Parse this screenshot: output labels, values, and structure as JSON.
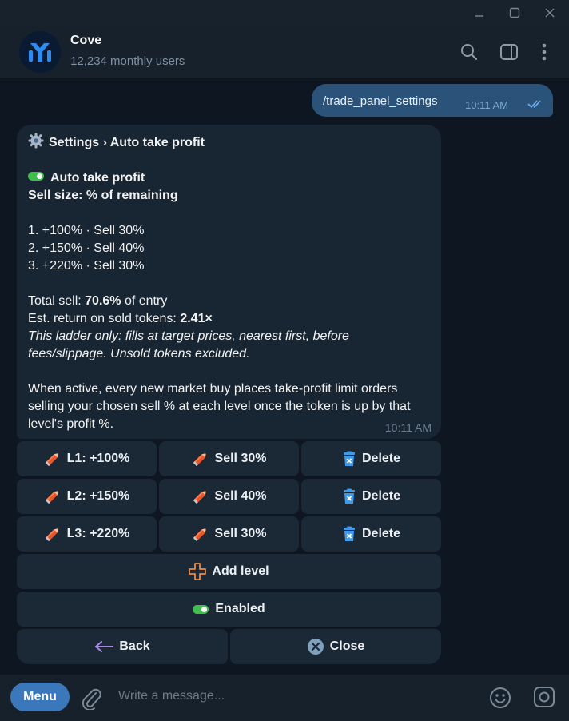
{
  "window": {
    "minimize": "minimize",
    "maximize": "maximize",
    "close": "close"
  },
  "header": {
    "title": "Cove",
    "subtitle": "12,234 monthly users",
    "icons": [
      "search-icon",
      "sidebar-icon",
      "more-icon"
    ]
  },
  "outgoing": {
    "text": "/trade_panel_settings",
    "time": "10:11 AM",
    "status": "read"
  },
  "incoming": {
    "breadcrumb": "Settings › Auto take profit",
    "toggle_label": "Auto take profit",
    "sell_size": "Sell size: % of remaining",
    "levels": [
      "1. +100% · Sell 30%",
      "2. +150% · Sell 40%",
      "3. +220% · Sell 30%"
    ],
    "total_prefix": "Total sell: ",
    "total_value": "70.6%",
    "total_suffix": " of entry",
    "est_prefix": "Est. return on sold tokens: ",
    "est_value": "2.41×",
    "note": "This ladder only: fills at target prices, nearest first, before fees/slippage. Unsold tokens excluded.",
    "description": "When active, every new market buy places take-profit limit orders selling your chosen sell % at each level once the token is up by that level's profit %.",
    "time": "10:11 AM"
  },
  "keyboard": {
    "rows": [
      [
        "L1: +100%",
        "Sell 30%",
        "Delete"
      ],
      [
        "L2: +150%",
        "Sell 40%",
        "Delete"
      ],
      [
        "L3: +220%",
        "Sell 30%",
        "Delete"
      ]
    ],
    "add_level": "Add level",
    "enabled": "Enabled",
    "back": "Back",
    "close": "Close"
  },
  "composer": {
    "menu": "Menu",
    "placeholder": "Write a message..."
  },
  "colors": {
    "accent": "#3a78bb",
    "toggle_on": "#3fbf4a",
    "bubble_out": "#2b5278",
    "bubble_in": "#182533"
  }
}
